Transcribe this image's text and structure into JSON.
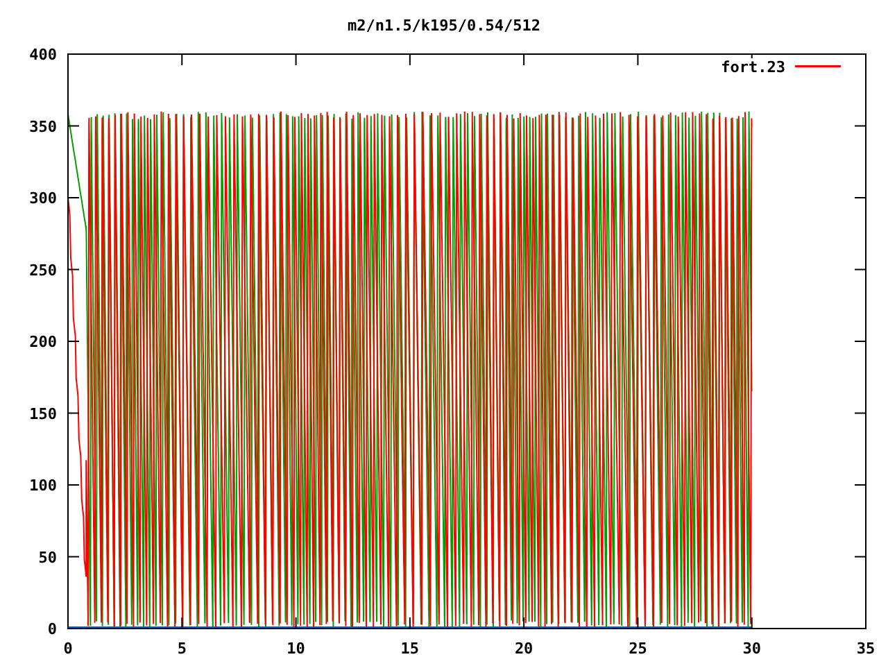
{
  "title": "m2/n1.5/k195/0.54/512",
  "legend": [
    {
      "label": "fort.23",
      "color": "#ff0000"
    }
  ],
  "y_axis": {
    "tick_labels": [
      "400",
      "350",
      "300",
      "250",
      "200",
      "150",
      "100",
      "50",
      "0"
    ]
  },
  "x_axis": {
    "tick_labels": [
      "0",
      "5",
      "10",
      "15",
      "20",
      "25",
      "30",
      "35"
    ]
  }
}
